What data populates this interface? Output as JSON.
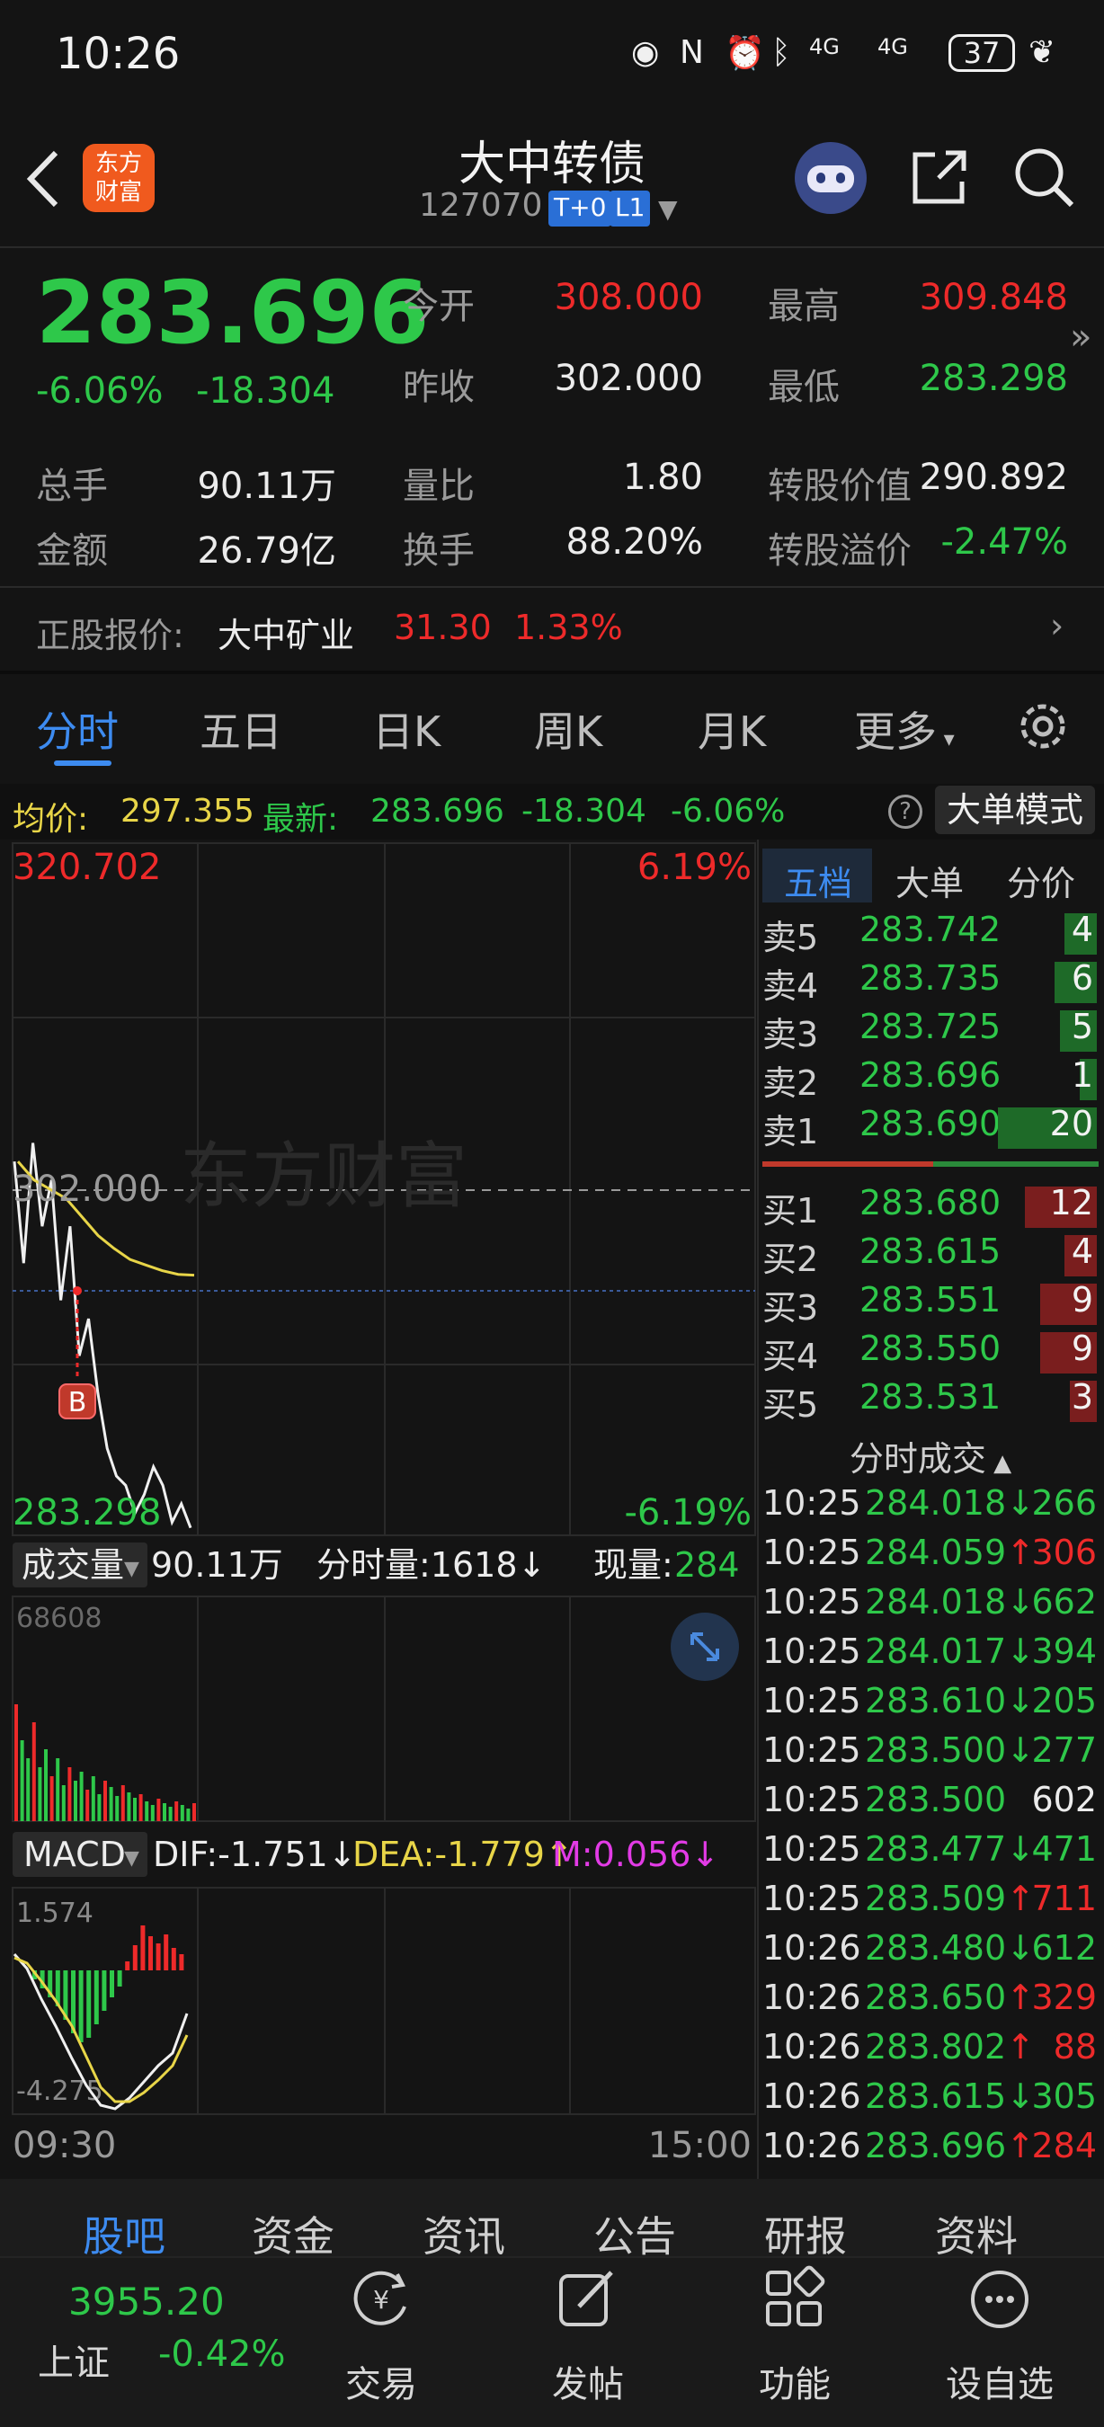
{
  "status_bar": {
    "time": "10:26",
    "battery": "37",
    "signal_labels": [
      "4G",
      "4G"
    ]
  },
  "header": {
    "logo_text": "东方\n财富",
    "title": "大中转债",
    "code": "127070",
    "tag_t0": "T+0",
    "tag_l1": "L1"
  },
  "quote": {
    "price": "283.696",
    "change_pct": "-6.06%",
    "change": "-18.304",
    "open_label": "今开",
    "open": "308.000",
    "high_label": "最高",
    "high": "309.848",
    "prev_close_label": "昨收",
    "prev_close": "302.000",
    "low_label": "最低",
    "low": "283.298",
    "volume_label": "总手",
    "volume": "90.11万",
    "vol_ratio_label": "量比",
    "vol_ratio": "1.80",
    "conv_value_label": "转股价值",
    "conv_value": "290.892",
    "amount_label": "金额",
    "amount": "26.79亿",
    "turnover_label": "换手",
    "turnover": "88.20%",
    "conv_premium_label": "转股溢价",
    "conv_premium": "-2.47%"
  },
  "underlying": {
    "label": "正股报价:",
    "name": "大中矿业",
    "price": "31.30",
    "pct": "1.33%"
  },
  "tabs": [
    "分时",
    "五日",
    "日K",
    "周K",
    "月K",
    "更多"
  ],
  "chart_info": {
    "avg_label": "均价:",
    "avg": "297.355",
    "latest_label": "最新:",
    "latest": "283.696",
    "change": "-18.304",
    "pct": "-6.06%",
    "big_order_mode": "大单模式"
  },
  "chart": {
    "y_max": "320.702",
    "y_max_pct": "6.19%",
    "y_mid": "302.000",
    "y_min": "283.298",
    "y_min_pct": "-6.19%",
    "watermark": "东方财富",
    "marker": "B",
    "volume_label": "成交量",
    "volume_total": "90.11万",
    "period_vol": "分时量:1618↓",
    "cur_vol_label": "现量:",
    "cur_vol": "284",
    "vol_max": "68608",
    "macd_label": "MACD",
    "dif": "DIF:-1.751↓",
    "dea": "DEA:-1.779↑",
    "m": "M:0.056↓",
    "macd_top": "1.574",
    "macd_bottom": "-4.275",
    "time_start": "09:30",
    "time_end": "15:00"
  },
  "chart_data": {
    "type": "line",
    "title": "",
    "xlabel": "",
    "ylabel": "",
    "ylim": [
      283.298,
      320.702
    ],
    "series": [
      {
        "name": "",
        "values": [
          303.5,
          298.0,
          304.5,
          300.0,
          302.5,
          296.0,
          300.0,
          293.0,
          295.0,
          291.0,
          288.0,
          286.5,
          286.0,
          284.5,
          285.5,
          287.0,
          286.0,
          284.0,
          285.0,
          283.7
        ]
      },
      {
        "name": "",
        "values": [
          303.5,
          302.5,
          302.0,
          301.5,
          300.5,
          299.5,
          298.8,
          298.2,
          297.9,
          297.6,
          297.4,
          297.355
        ]
      }
    ]
  },
  "order_book": {
    "tabs": [
      "五档",
      "大单",
      "分价"
    ],
    "asks": [
      {
        "label": "卖5",
        "price": "283.742",
        "qty": "4"
      },
      {
        "label": "卖4",
        "price": "283.735",
        "qty": "6"
      },
      {
        "label": "卖3",
        "price": "283.725",
        "qty": "5"
      },
      {
        "label": "卖2",
        "price": "283.696",
        "qty": "1"
      },
      {
        "label": "卖1",
        "price": "283.690",
        "qty": "20"
      }
    ],
    "bids": [
      {
        "label": "买1",
        "price": "283.680",
        "qty": "12"
      },
      {
        "label": "买2",
        "price": "283.615",
        "qty": "4"
      },
      {
        "label": "买3",
        "price": "283.551",
        "qty": "9"
      },
      {
        "label": "买4",
        "price": "283.550",
        "qty": "9"
      },
      {
        "label": "买5",
        "price": "283.531",
        "qty": "3"
      }
    ],
    "trades_title": "分时成交",
    "trades": [
      {
        "time": "10:25",
        "price": "284.018↓",
        "vol": "266",
        "dir": "down"
      },
      {
        "time": "10:25",
        "price": "284.059↑",
        "vol": "306",
        "dir": "up"
      },
      {
        "time": "10:25",
        "price": "284.018↓",
        "vol": "662",
        "dir": "down"
      },
      {
        "time": "10:25",
        "price": "284.017↓",
        "vol": "394",
        "dir": "down"
      },
      {
        "time": "10:25",
        "price": "283.610↓",
        "vol": "205",
        "dir": "down"
      },
      {
        "time": "10:25",
        "price": "283.500↓",
        "vol": "277",
        "dir": "down"
      },
      {
        "time": "10:25",
        "price": "283.500",
        "vol": "602",
        "dir": "flat"
      },
      {
        "time": "10:25",
        "price": "283.477↓",
        "vol": "471",
        "dir": "down"
      },
      {
        "time": "10:25",
        "price": "283.509↑",
        "vol": "711",
        "dir": "up"
      },
      {
        "time": "10:26",
        "price": "283.480↓",
        "vol": "612",
        "dir": "down"
      },
      {
        "time": "10:26",
        "price": "283.650↑",
        "vol": "329",
        "dir": "up"
      },
      {
        "time": "10:26",
        "price": "283.802↑",
        "vol": "88",
        "dir": "up"
      },
      {
        "time": "10:26",
        "price": "283.615↓",
        "vol": "305",
        "dir": "down"
      },
      {
        "time": "10:26",
        "price": "283.696↑",
        "vol": "284",
        "dir": "up"
      }
    ]
  },
  "bottom_tabs": [
    "股吧",
    "资金",
    "资讯",
    "公告",
    "研报",
    "资料"
  ],
  "bottom_nav": {
    "index_value": "3955.20",
    "index_name": "上证",
    "index_pct": "-0.42%",
    "trade": "交易",
    "post": "发帖",
    "functions": "功能",
    "add_watch": "设自选"
  },
  "colors": {
    "up": "#ee2a2a",
    "down": "#2ec84a",
    "accent": "#2a6fd6",
    "avg_line": "#e8d548"
  }
}
